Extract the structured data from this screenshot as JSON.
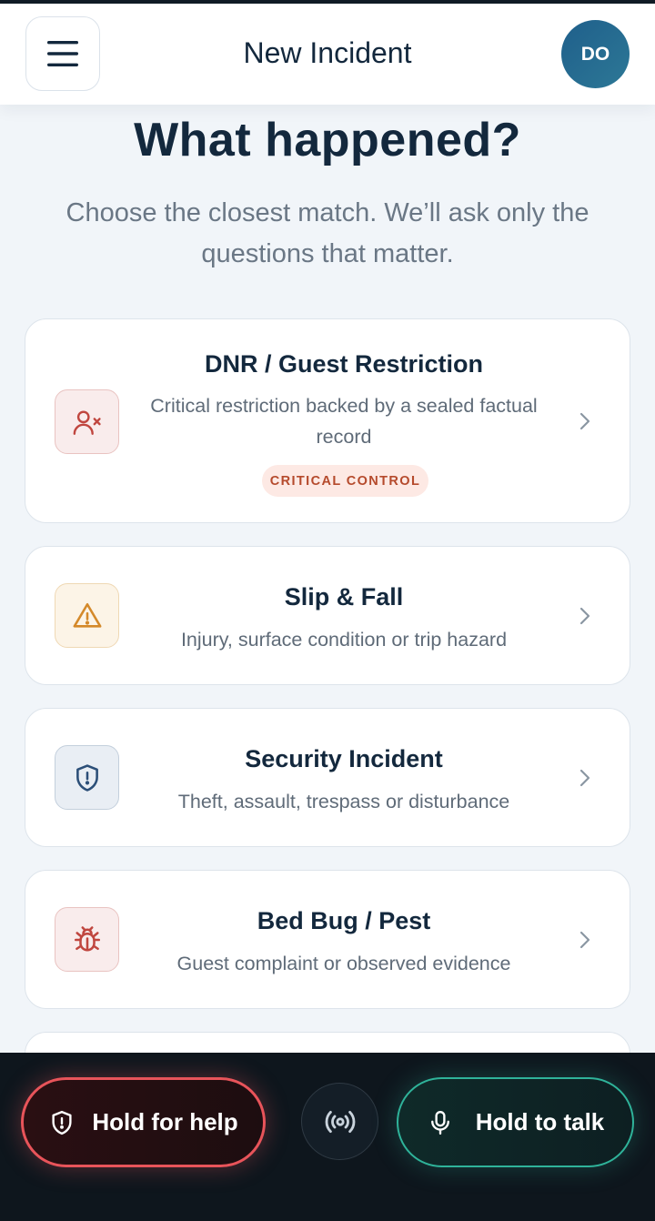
{
  "header": {
    "title": "New Incident",
    "avatar_initials": "DO"
  },
  "intro": {
    "title": "What happened?",
    "subtitle": "Choose the closest match. We’ll ask only the questions that matter."
  },
  "incident_types": [
    {
      "title": "DNR / Guest Restriction",
      "description": "Critical restriction backed by a sealed factual record",
      "badge": "CRITICAL CONTROL",
      "icon": "user-x-icon",
      "color": "#c0463f"
    },
    {
      "title": "Slip & Fall",
      "description": "Injury, surface condition or trip hazard",
      "icon": "warning-triangle-icon",
      "color": "#d4892a"
    },
    {
      "title": "Security Incident",
      "description": "Theft, assault, trespass or disturbance",
      "icon": "shield-alert-icon",
      "color": "#2c4f78"
    },
    {
      "title": "Bed Bug / Pest",
      "description": "Guest complaint or observed evidence",
      "icon": "bug-icon",
      "color": "#c0463f"
    }
  ],
  "bottom_bar": {
    "help_label": "Hold for help",
    "talk_label": "Hold to talk",
    "help_color": "#e8545a",
    "talk_color": "#2fb39a"
  }
}
